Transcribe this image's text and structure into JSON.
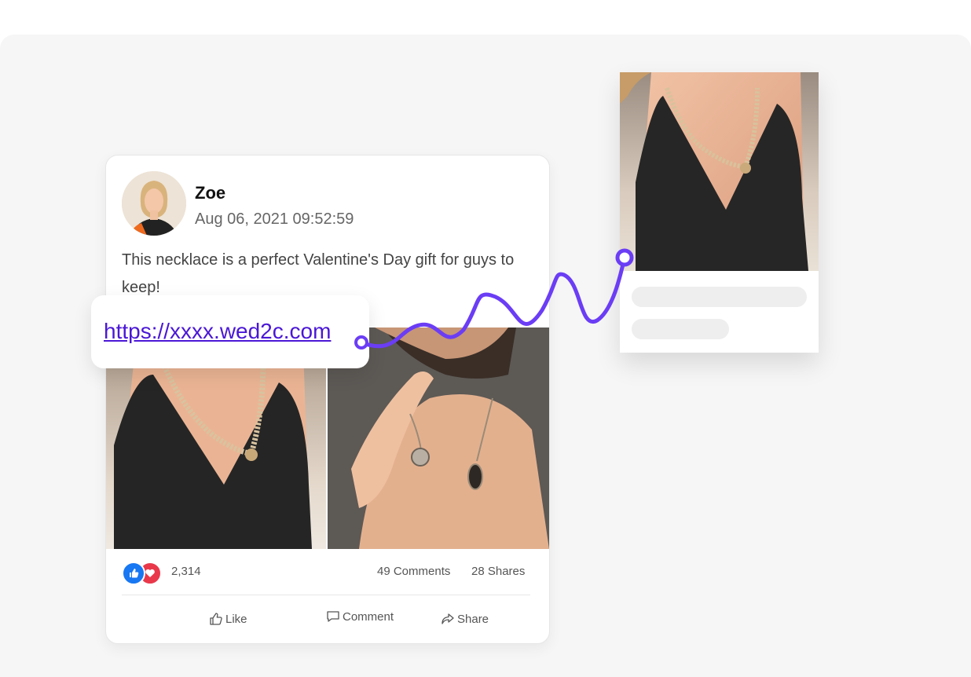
{
  "post": {
    "author": "Zoe",
    "timestamp": "Aug 06, 2021 09:52:59",
    "text": "This necklace is a perfect Valentine's Day gift for guys to keep!",
    "reaction_count": "2,314",
    "comments": "49 Comments",
    "shares": "28 Shares",
    "actions": {
      "like": "Like",
      "comment": "Comment",
      "share": "Share"
    }
  },
  "link": {
    "url": "https://xxxx.wed2c.com"
  },
  "colors": {
    "accent": "#6b3df5",
    "link": "#4a17d6",
    "like_blue": "#1877f2",
    "love_red": "#e9384a",
    "skeleton": "#eeeeee"
  },
  "icons": {
    "reaction_like": "thumbs-up-icon",
    "reaction_love": "heart-icon",
    "like": "thumbs-up-outline-icon",
    "comment": "speech-bubble-icon",
    "share": "share-arrow-icon"
  }
}
